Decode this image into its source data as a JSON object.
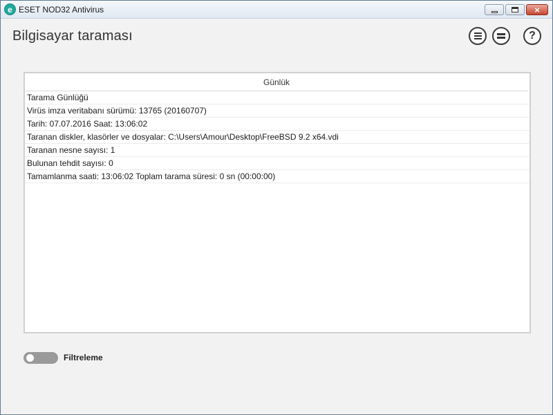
{
  "window": {
    "title": "ESET NOD32 Antivirus",
    "logo_letter": "e",
    "controls": {
      "minimize": "minimize-icon",
      "maximize": "maximize-icon",
      "close": "×"
    }
  },
  "header": {
    "title": "Bilgisayar taraması",
    "icons": [
      "list-icon",
      "menu-icon",
      "help-icon"
    ],
    "help_glyph": "?"
  },
  "log": {
    "column_header": "Günlük",
    "rows": [
      "Tarama Günlüğü",
      "Virüs imza veritabanı sürümü: 13765 (20160707)",
      "Tarih: 07.07.2016  Saat: 13:06:02",
      "Taranan diskler, klasörler ve dosyalar: C:\\Users\\Amour\\Desktop\\FreeBSD 9.2 x64.vdi",
      "Taranan nesne sayısı: 1",
      "Bulunan tehdit sayısı: 0",
      "Tamamlanma saati: 13:06:02  Toplam tarama süresi: 0 sn (00:00:00)"
    ]
  },
  "filter": {
    "label": "Filtreleme",
    "enabled": false
  },
  "colors": {
    "accent": "#21a99c",
    "toggle_off": "#9a9a9a",
    "close_button": "#c7442e"
  }
}
